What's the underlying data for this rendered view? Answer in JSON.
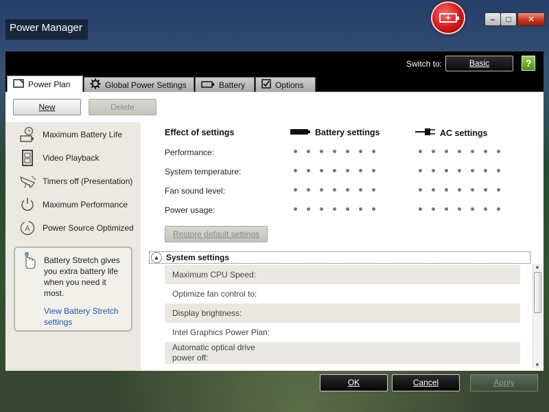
{
  "window": {
    "title": "Power Manager",
    "controls": {
      "minimize": "–",
      "maximize": "□",
      "close": "✕"
    }
  },
  "header": {
    "switch_to_label": "Switch to:",
    "basic_button": "Basic",
    "help_icon": "?"
  },
  "tabs": [
    {
      "label": "Power Plan",
      "icon": "document-icon",
      "active": true
    },
    {
      "label": "Global Power Settings",
      "icon": "gear-icon",
      "active": false
    },
    {
      "label": "Battery",
      "icon": "battery-icon",
      "active": false
    },
    {
      "label": "Options",
      "icon": "checkbox-icon",
      "active": false
    }
  ],
  "toolbar": {
    "new_label": "New",
    "delete_label": "Delete"
  },
  "plans": [
    {
      "label": "Maximum Battery Life",
      "icon": "battery-clock-icon"
    },
    {
      "label": "Video Playback",
      "icon": "film-icon"
    },
    {
      "label": "Timers off (Presentation)",
      "icon": "projector-icon"
    },
    {
      "label": "Maximum Performance",
      "icon": "power-icon"
    },
    {
      "label": "Power Source Optimized",
      "icon": "auto-cycle-icon"
    }
  ],
  "stretch": {
    "text": "Battery Stretch gives you extra battery life when you need it most.",
    "link": "View Battery Stretch settings"
  },
  "effects": {
    "heading": "Effect of settings",
    "battery_heading": "Battery settings",
    "ac_heading": "AC settings",
    "rows": [
      {
        "label": "Performance:"
      },
      {
        "label": "System temperature:"
      },
      {
        "label": "Fan sound level:"
      },
      {
        "label": "Power usage:"
      }
    ],
    "restore_label": "Restore default settings"
  },
  "system_settings": {
    "heading": "System settings",
    "rows": [
      {
        "label": "Maximum CPU Speed:"
      },
      {
        "label": "Optimize fan control to:"
      },
      {
        "label": "Display brightness:"
      },
      {
        "label": "Intel Graphics Power Plan:"
      },
      {
        "label": "Automatic optical drive power off:"
      }
    ]
  },
  "footer": {
    "ok": "OK",
    "cancel": "Cancel",
    "apply": "Apply"
  },
  "colors": {
    "accent_link": "#1c58b5",
    "header_bg": "#000000",
    "sidebar_bg": "#ece9e2",
    "badge_red": "#d51515"
  }
}
